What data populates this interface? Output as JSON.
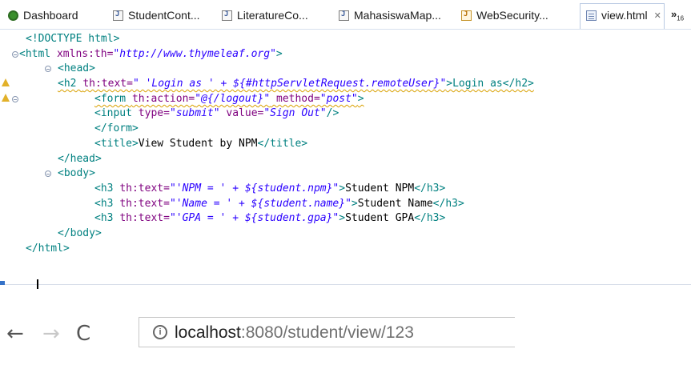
{
  "editor": {
    "tabs": [
      {
        "label": "Dashboard",
        "icon": "dashboard-icon"
      },
      {
        "label": "StudentCont...",
        "icon": "java-file-icon"
      },
      {
        "label": "LiteratureCo...",
        "icon": "java-file-icon"
      },
      {
        "label": "MahasiswaMap...",
        "icon": "java-file-icon"
      },
      {
        "label": "WebSecurity...",
        "icon": "java-file-icon"
      },
      {
        "label": "view.html",
        "icon": "html-file-icon",
        "close": "✕",
        "active": true
      }
    ],
    "overflow": {
      "label": "»",
      "count": "16"
    },
    "lines": [
      {
        "parts": [
          "<!DOCTYPE html>"
        ]
      },
      {
        "parts": [
          "<html ",
          "xmlns:th=",
          "\"http://www.thymeleaf.org\"",
          ">"
        ]
      },
      {
        "parts": [
          "<head>"
        ]
      },
      {
        "parts": [
          "<h2 ",
          "th:text=",
          "\" 'Login as ' + ${#httpServletRequest.remoteUser}\"",
          ">Login as</h2>"
        ]
      },
      {
        "parts": [
          "<form ",
          "th:action=",
          "\"@{/logout}\"",
          " method=",
          "\"post\"",
          ">"
        ]
      },
      {
        "parts": [
          "<input ",
          "type=",
          "\"submit\"",
          " value=",
          "\"Sign Out\"",
          "/>"
        ]
      },
      {
        "parts": [
          "</form>"
        ]
      },
      {
        "parts": [
          "<title>",
          "View Student by NPM",
          "</title>"
        ]
      },
      {
        "parts": [
          "</head>"
        ]
      },
      {
        "parts": [
          "<body>"
        ]
      },
      {
        "parts": [
          "<h3 ",
          "th:text=",
          "\"'NPM = ' + ${student.npm}\"",
          ">",
          "Student NPM",
          "</h3>"
        ]
      },
      {
        "parts": [
          "<h3 ",
          "th:text=",
          "\"'Name = ' + ${student.name}\"",
          ">",
          "Student Name",
          "</h3>"
        ]
      },
      {
        "parts": [
          "<h3 ",
          "th:text=",
          "\"'GPA = ' + ${student.gpa}\"",
          ">",
          "Student GPA",
          "</h3>"
        ]
      },
      {
        "parts": [
          "</body>"
        ]
      },
      {
        "parts": [
          "</html>"
        ]
      }
    ]
  },
  "browser": {
    "back": "←",
    "forward": "→",
    "reload": "C",
    "info": "i",
    "url_host": "localhost",
    "url_path": ":8080/student/view/123"
  }
}
